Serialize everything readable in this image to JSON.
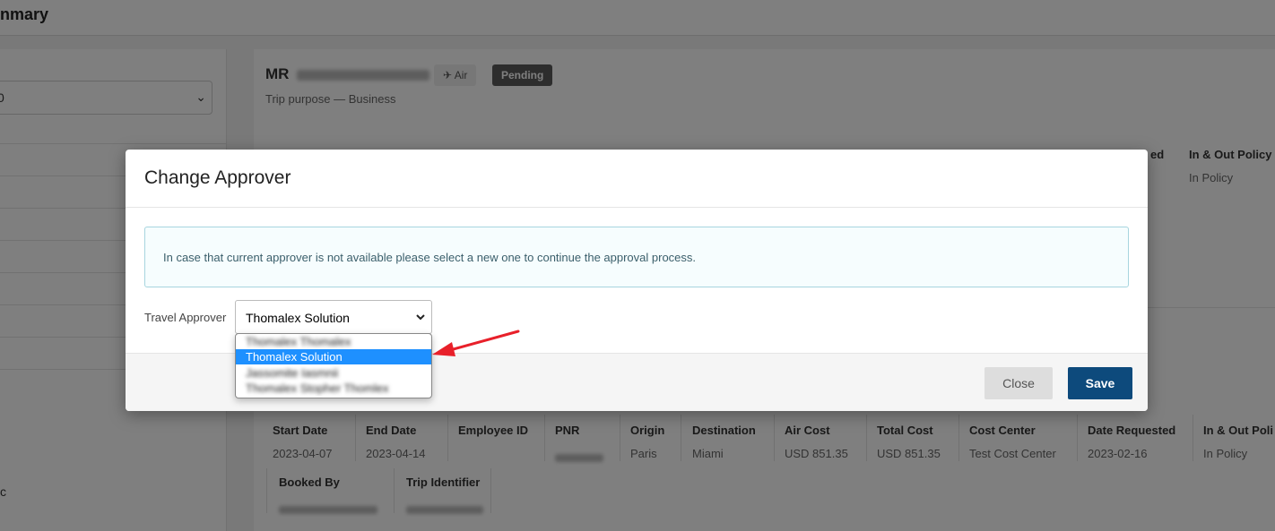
{
  "background": {
    "page_title": "nmary",
    "sidebar_select_value": "0",
    "sidebar_tail_text": "c",
    "traveler_prefix": "MR",
    "tag_air": "Air",
    "tag_status": "Pending",
    "trip_purpose": "Trip purpose — Business",
    "top_columns": [
      {
        "head": "ed",
        "value": ""
      },
      {
        "head": "In & Out Policy",
        "value": "In Policy"
      }
    ],
    "columns": [
      {
        "head": "Start Date",
        "value": "2023-04-07"
      },
      {
        "head": "End Date",
        "value": "2023-04-14"
      },
      {
        "head": "Employee ID",
        "value": ""
      },
      {
        "head": "PNR",
        "value": ""
      },
      {
        "head": "Origin",
        "value": "Paris"
      },
      {
        "head": "Destination",
        "value": "Miami"
      },
      {
        "head": "Air Cost",
        "value": "USD 851.35"
      },
      {
        "head": "Total Cost",
        "value": "USD 851.35"
      },
      {
        "head": "Cost Center",
        "value": "Test Cost Center"
      },
      {
        "head": "Date Requested",
        "value": "2023-02-16"
      },
      {
        "head": "In & Out Poli",
        "value": "In Policy"
      }
    ],
    "columns_row2": [
      {
        "head": "Booked By",
        "value": ""
      },
      {
        "head": "Trip Identifier",
        "value": ""
      }
    ]
  },
  "modal": {
    "title": "Change Approver",
    "info_text": "In case that current approver is not available please select a new one to continue the approval process.",
    "field_label": "Travel Approver",
    "select_value": "Thomalex Solution",
    "options": [
      {
        "label": "Thomalex Thomalex",
        "selected": false,
        "blurred": true
      },
      {
        "label": "Thomalex Solution",
        "selected": true,
        "blurred": false
      },
      {
        "label": "Jassomite Iasmnii",
        "selected": false,
        "blurred": true
      },
      {
        "label": "Thomalex Stopher Thomlex",
        "selected": false,
        "blurred": true
      }
    ],
    "close_label": "Close",
    "save_label": "Save"
  },
  "colors": {
    "save_button": "#0d4a7c",
    "selected_option": "#1e90ff",
    "annotation_arrow": "#e8202a"
  }
}
